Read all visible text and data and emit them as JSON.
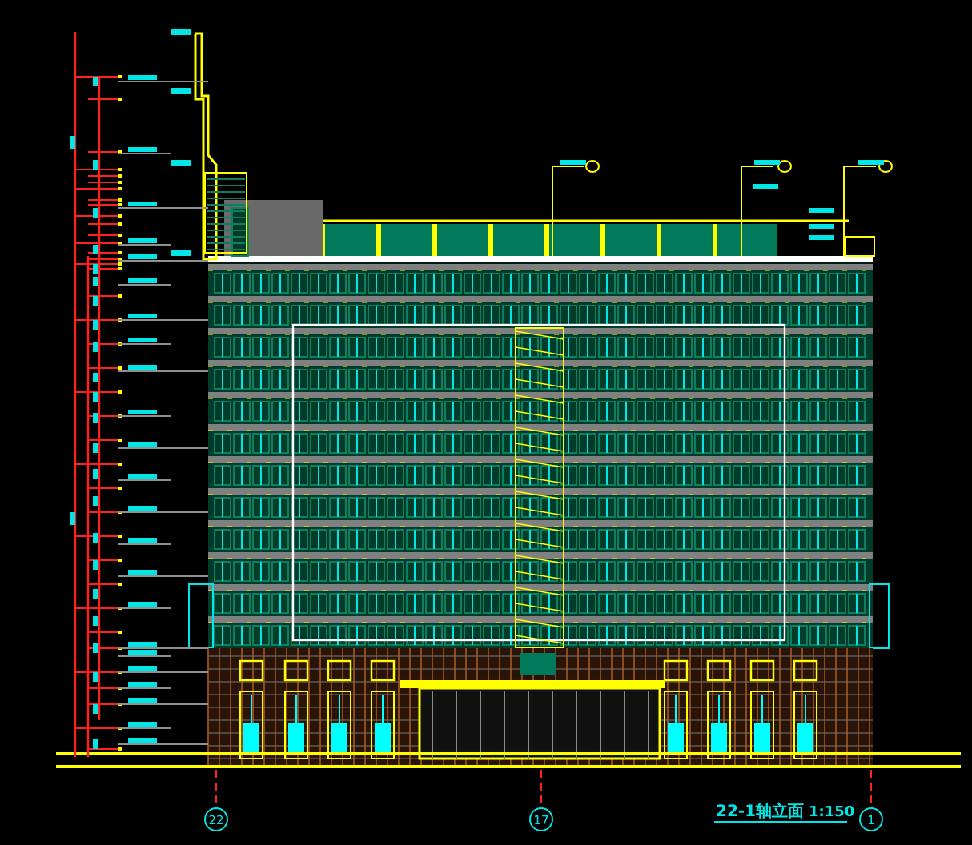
{
  "drawing": {
    "title": "22-1轴立面",
    "scale": "1:150",
    "grid_axes": [
      {
        "label": "22"
      },
      {
        "label": "17"
      },
      {
        "label": "1"
      }
    ]
  }
}
